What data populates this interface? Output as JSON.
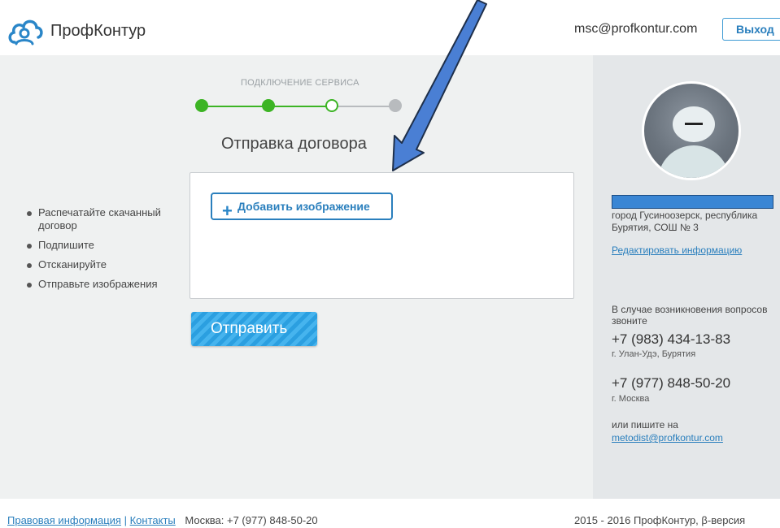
{
  "header": {
    "brand": "ПрофКонтур",
    "user_email": "msc@profkontur.com",
    "logout_label": "Выход"
  },
  "wizard": {
    "caption": "ПОДКЛЮЧЕНИЕ СЕРВИСА",
    "steps_total": 4,
    "current_step": 3,
    "title": "Отправка договора"
  },
  "instructions": [
    "Распечатайте скачанный договор",
    "Подпишите",
    "Отсканируйте",
    "Отправьте изображения"
  ],
  "upload": {
    "add_image_label": "Добавить изображение"
  },
  "submit_label": "Отправить",
  "profile": {
    "location": "город Гусиноозерск, республика Бурятия, СОШ № 3",
    "edit_link": "Редактировать информацию"
  },
  "contacts": {
    "intro": "В случае возникновения вопросов звоните",
    "phone1": "+7 (983) 434-13-83",
    "city1": "г. Улан-Удэ, Бурятия",
    "phone2": "+7 (977) 848-50-20",
    "city2": "г. Москва",
    "write_note": "или пишите на",
    "email": "metodist@profkontur.com"
  },
  "footer": {
    "legal_link": "Правовая информация",
    "separator": "|",
    "contacts_link": "Контакты",
    "moscow_phone": "Москва: +7 (977) 848-50-20",
    "copyright": "2015 - 2016 ПрофКонтур, β-версия"
  },
  "colors": {
    "accent": "#2a7fbd",
    "step_done": "#3cb424",
    "step_todo": "#b8bbbe",
    "submit_bg": "#2b9fe0",
    "annotation_arrow": "#4a7fd4"
  }
}
